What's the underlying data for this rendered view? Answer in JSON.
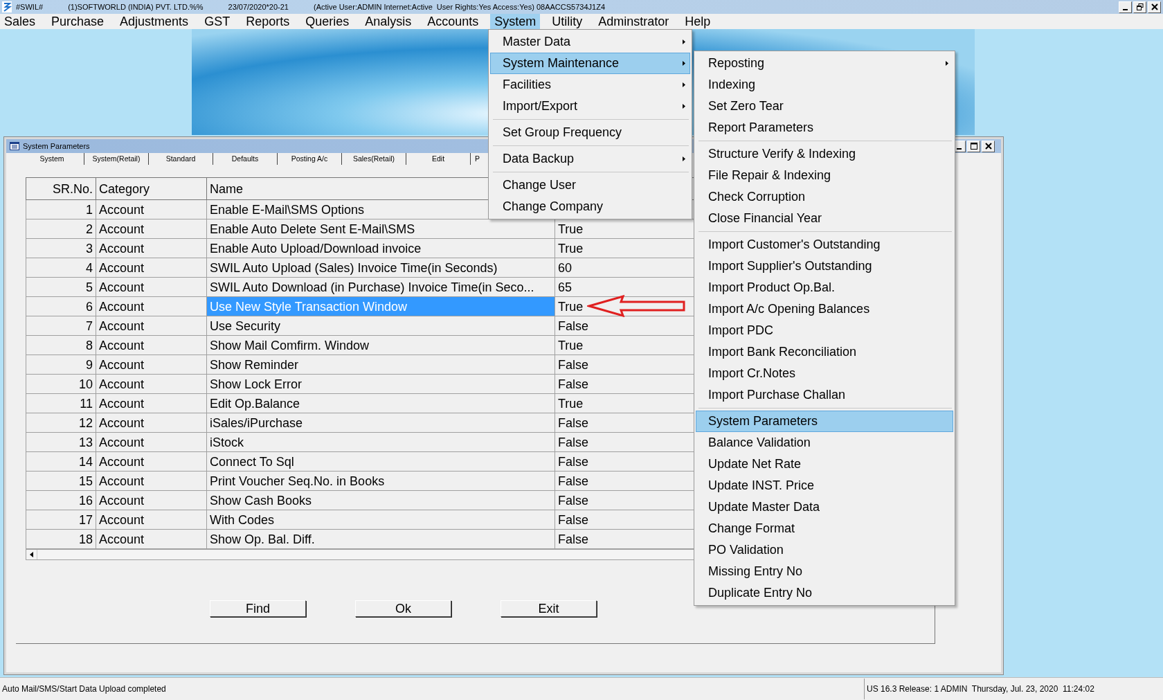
{
  "window": {
    "title_items": [
      "#SWIL#",
      "(1)SOFTWORLD (INDIA) PVT. LTD.%%",
      "23/07/2020*20-21",
      "(Active User:ADMIN Internet:Active  User Rights:Yes Access:Yes) 08AACCS5734J1Z4"
    ]
  },
  "menu_bar": [
    {
      "label": "Sales",
      "selected": false
    },
    {
      "label": "Purchase",
      "selected": false
    },
    {
      "label": "Adjustments",
      "selected": false
    },
    {
      "label": "GST",
      "selected": false
    },
    {
      "label": "Reports",
      "selected": false
    },
    {
      "label": "Queries",
      "selected": false
    },
    {
      "label": "Analysis",
      "selected": false
    },
    {
      "label": "Accounts",
      "selected": false
    },
    {
      "label": "System",
      "selected": true
    },
    {
      "label": "Utility",
      "selected": false
    },
    {
      "label": "Adminstrator",
      "selected": false
    },
    {
      "label": "Help",
      "selected": false
    }
  ],
  "system_menu": [
    {
      "kind": "item",
      "label": "Master Data",
      "has_submenu": true,
      "selected": false
    },
    {
      "kind": "item",
      "label": "System Maintenance",
      "has_submenu": true,
      "selected": true
    },
    {
      "kind": "item",
      "label": "Facilities",
      "has_submenu": true,
      "selected": false
    },
    {
      "kind": "item",
      "label": "Import/Export",
      "has_submenu": true,
      "selected": false
    },
    {
      "kind": "separator"
    },
    {
      "kind": "item",
      "label": "Set Group Frequency",
      "has_submenu": false,
      "selected": false
    },
    {
      "kind": "separator"
    },
    {
      "kind": "item",
      "label": "Data Backup",
      "has_submenu": true,
      "selected": false
    },
    {
      "kind": "separator"
    },
    {
      "kind": "item",
      "label": "Change User",
      "has_submenu": false,
      "selected": false
    },
    {
      "kind": "item",
      "label": "Change Company",
      "has_submenu": false,
      "selected": false
    }
  ],
  "maintenance_menu": [
    {
      "kind": "item",
      "label": "Reposting",
      "has_submenu": true,
      "selected": false
    },
    {
      "kind": "item",
      "label": "Indexing",
      "has_submenu": false,
      "selected": false
    },
    {
      "kind": "item",
      "label": "Set Zero Tear",
      "has_submenu": false,
      "selected": false
    },
    {
      "kind": "item",
      "label": "Report Parameters",
      "has_submenu": false,
      "selected": false
    },
    {
      "kind": "separator"
    },
    {
      "kind": "item",
      "label": "Structure Verify & Indexing",
      "has_submenu": false,
      "selected": false
    },
    {
      "kind": "item",
      "label": "File Repair & Indexing",
      "has_submenu": false,
      "selected": false
    },
    {
      "kind": "item",
      "label": "Check Corruption",
      "has_submenu": false,
      "selected": false
    },
    {
      "kind": "item",
      "label": "Close Financial Year",
      "has_submenu": false,
      "selected": false
    },
    {
      "kind": "separator"
    },
    {
      "kind": "item",
      "label": "Import Customer's Outstanding",
      "has_submenu": false,
      "selected": false
    },
    {
      "kind": "item",
      "label": "Import Supplier's Outstanding",
      "has_submenu": false,
      "selected": false
    },
    {
      "kind": "item",
      "label": "Import Product Op.Bal.",
      "has_submenu": false,
      "selected": false
    },
    {
      "kind": "item",
      "label": "Import A/c Opening Balances",
      "has_submenu": false,
      "selected": false
    },
    {
      "kind": "item",
      "label": "Import PDC",
      "has_submenu": false,
      "selected": false
    },
    {
      "kind": "item",
      "label": "Import Bank Reconciliation",
      "has_submenu": false,
      "selected": false
    },
    {
      "kind": "item",
      "label": "Import Cr.Notes",
      "has_submenu": false,
      "selected": false
    },
    {
      "kind": "item",
      "label": "Import Purchase Challan",
      "has_submenu": false,
      "selected": false
    },
    {
      "kind": "separator"
    },
    {
      "kind": "item",
      "label": "System Parameters",
      "has_submenu": false,
      "selected": true
    },
    {
      "kind": "item",
      "label": "Balance Validation",
      "has_submenu": false,
      "selected": false
    },
    {
      "kind": "item",
      "label": "Update Net Rate",
      "has_submenu": false,
      "selected": false
    },
    {
      "kind": "item",
      "label": "Update INST. Price",
      "has_submenu": false,
      "selected": false
    },
    {
      "kind": "item",
      "label": "Update Master Data",
      "has_submenu": false,
      "selected": false
    },
    {
      "kind": "item",
      "label": "Change Format",
      "has_submenu": false,
      "selected": false
    },
    {
      "kind": "item",
      "label": "PO Validation",
      "has_submenu": false,
      "selected": false
    },
    {
      "kind": "item",
      "label": "Missing Entry No",
      "has_submenu": false,
      "selected": false
    },
    {
      "kind": "item",
      "label": "Duplicate Entry No",
      "has_submenu": false,
      "selected": false
    }
  ],
  "child_window": {
    "title": "System Parameters",
    "tabs": [
      "System",
      "System(Retail)",
      "Standard",
      "Defaults",
      "Posting A/c",
      "Sales(Retail)",
      "Edit",
      "P"
    ],
    "table": {
      "columns": [
        "SR.No.",
        "Category",
        "Name"
      ],
      "rows": [
        {
          "sr": "1",
          "category": "Account",
          "name": "Enable E-Mail\\SMS Options",
          "selected": false
        },
        {
          "sr": "2",
          "category": "Account",
          "name": "Enable Auto Delete Sent E-Mail\\SMS",
          "value": "True",
          "selected": false
        },
        {
          "sr": "3",
          "category": "Account",
          "name": "Enable Auto Upload/Download invoice",
          "value": "True",
          "selected": false
        },
        {
          "sr": "4",
          "category": "Account",
          "name": "SWIL Auto Upload (Sales) Invoice Time(in Seconds)",
          "value": "60",
          "selected": false
        },
        {
          "sr": "5",
          "category": "Account",
          "name": "SWIL Auto Download (in Purchase) Invoice Time(in Seco...",
          "value": "65",
          "selected": false
        },
        {
          "sr": "6",
          "category": "Account",
          "name": "Use New Style Transaction Window",
          "value": "True",
          "selected": true
        },
        {
          "sr": "7",
          "category": "Account",
          "name": "Use Security",
          "value": "False",
          "selected": false
        },
        {
          "sr": "8",
          "category": "Account",
          "name": "Show Mail Comfirm. Window",
          "value": "True",
          "selected": false
        },
        {
          "sr": "9",
          "category": "Account",
          "name": "Show Reminder",
          "value": "False",
          "selected": false
        },
        {
          "sr": "10",
          "category": "Account",
          "name": "Show Lock Error",
          "value": "False",
          "selected": false
        },
        {
          "sr": "11",
          "category": "Account",
          "name": "Edit Op.Balance",
          "value": "True",
          "selected": false
        },
        {
          "sr": "12",
          "category": "Account",
          "name": "iSales/iPurchase",
          "value": "False",
          "selected": false
        },
        {
          "sr": "13",
          "category": "Account",
          "name": "iStock",
          "value": "False",
          "selected": false
        },
        {
          "sr": "14",
          "category": "Account",
          "name": "Connect To Sql",
          "value": "False",
          "selected": false
        },
        {
          "sr": "15",
          "category": "Account",
          "name": "Print Voucher Seq.No. in Books",
          "value": "False",
          "selected": false
        },
        {
          "sr": "16",
          "category": "Account",
          "name": "Show Cash Books",
          "value": "False",
          "selected": false
        },
        {
          "sr": "17",
          "category": "Account",
          "name": "With Codes",
          "value": "False",
          "selected": false
        },
        {
          "sr": "18",
          "category": "Account",
          "name": "Show Op. Bal. Diff.",
          "value": "False",
          "selected": false
        }
      ]
    },
    "buttons": [
      "Find",
      "Ok",
      "Exit"
    ]
  },
  "status_bar": {
    "message": "Auto Mail/SMS/Start Data Upload completed",
    "info": "US 16.3 Release: 1 ADMIN  Thursday, Jul. 23, 2020  11:24:02"
  }
}
